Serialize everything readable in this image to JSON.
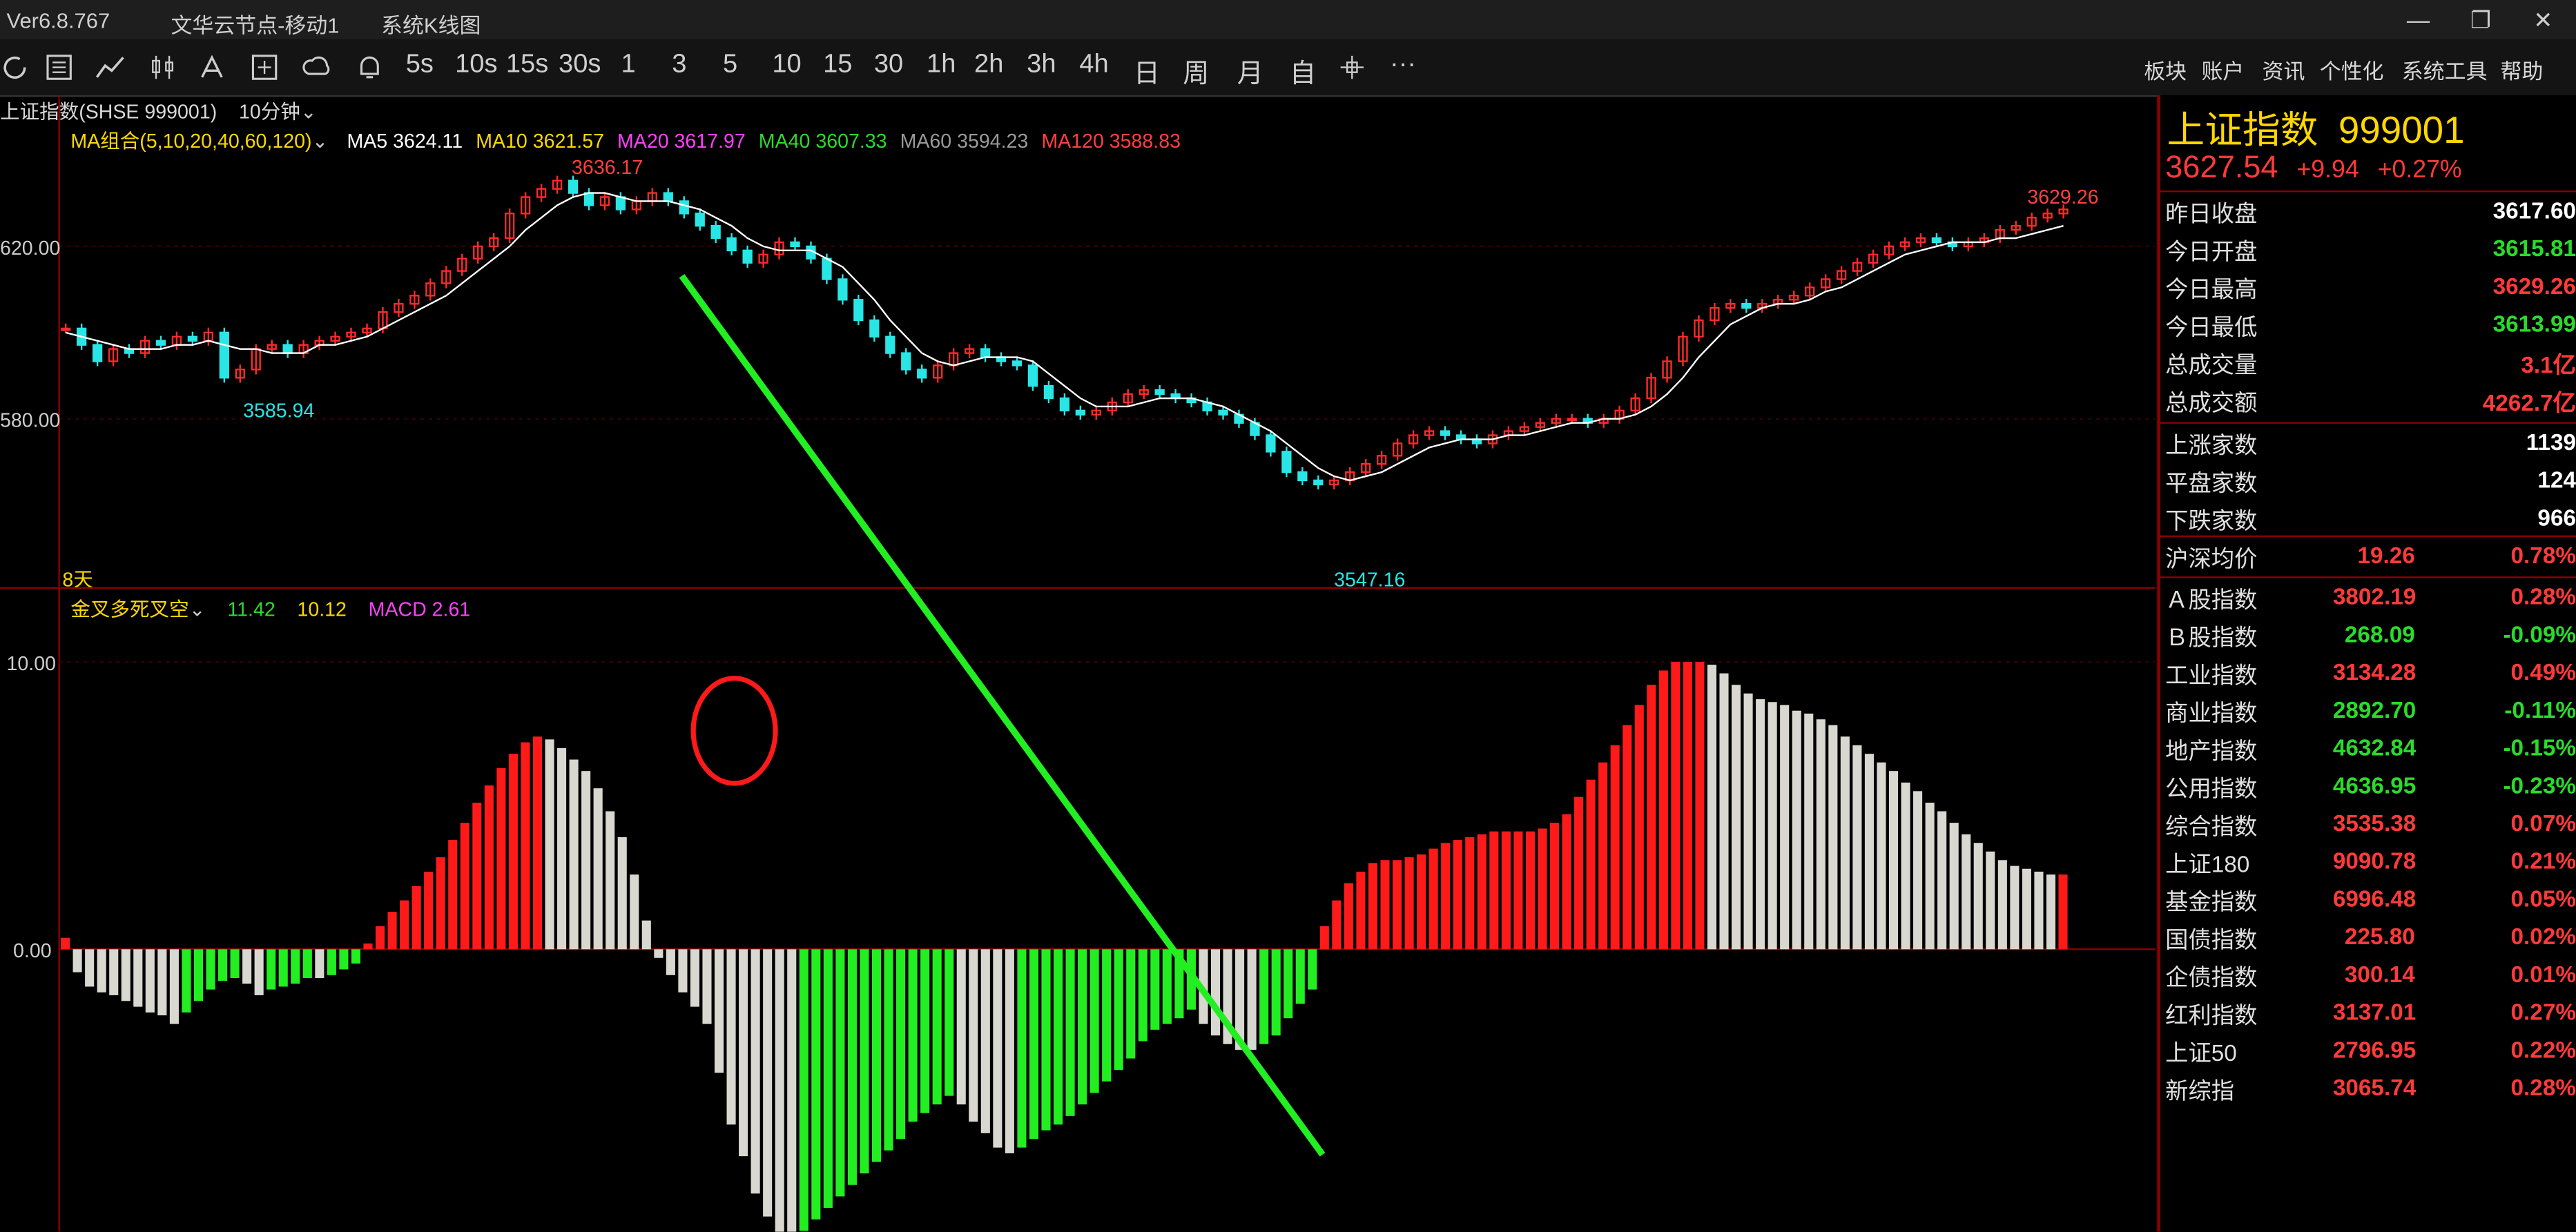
{
  "titlebar": {
    "version": "Ver6.8.767",
    "node": "文华云节点-移动1",
    "chart_name": "系统K线图",
    "minimize": "—",
    "restore": "❐",
    "close": "✕"
  },
  "toolbar": {
    "periods": [
      "5s",
      "10s",
      "15s",
      "30s",
      "1",
      "3",
      "5",
      "10",
      "15",
      "30",
      "1h",
      "2h",
      "3h",
      "4h",
      "日",
      "周",
      "月",
      "自"
    ],
    "menus": [
      "板块",
      "账户",
      "资讯",
      "个性化",
      "系统工具",
      "帮助"
    ],
    "more": "···"
  },
  "chart_header": {
    "symbol": "上证指数(SHSE  999001)",
    "period": "10分钟",
    "ma_label": "MA组合(5,10,20,40,60,120)",
    "ma": [
      {
        "text": "MA5 3624.11",
        "color": "#ffffff"
      },
      {
        "text": "MA10 3621.57",
        "color": "#ffd700"
      },
      {
        "text": "MA20 3617.97",
        "color": "#ff40ff"
      },
      {
        "text": "MA40 3607.33",
        "color": "#2bdb2b"
      },
      {
        "text": "MA60 3594.23",
        "color": "#9a9a9a"
      },
      {
        "text": "MA120 3588.83",
        "color": "#ff4040"
      }
    ],
    "days_label": "8天"
  },
  "price_annotations": {
    "high": "3636.17",
    "low_left": "3585.94",
    "low_mid": "3547.16",
    "high_right": "3629.26"
  },
  "y_labels_price": [
    "620.00",
    "580.00"
  ],
  "indicator_header": {
    "name": "金叉多死叉空",
    "v1": "11.42",
    "v2": "10.12",
    "macd": "MACD 2.61"
  },
  "y_labels_macd": [
    "10.00",
    "0.00"
  ],
  "quote": {
    "name": "上证指数",
    "code": "999001",
    "price": "3627.54",
    "change": "+9.94",
    "pct": "+0.27%"
  },
  "stats": [
    {
      "label": "昨日收盘",
      "value": "3617.60",
      "color": "white"
    },
    {
      "label": "今日开盘",
      "value": "3615.81",
      "color": "green"
    },
    {
      "label": "今日最高",
      "value": "3629.26",
      "color": "red"
    },
    {
      "label": "今日最低",
      "value": "3613.99",
      "color": "green"
    },
    {
      "label": "总成交量",
      "value": "3.1亿",
      "color": "red"
    },
    {
      "label": "总成交额",
      "value": "4262.7亿",
      "color": "red"
    }
  ],
  "breadth": [
    {
      "label": "上涨家数",
      "value": "1139"
    },
    {
      "label": "平盘家数",
      "value": "124"
    },
    {
      "label": "下跌家数",
      "value": "966"
    }
  ],
  "hs_avg": {
    "label": "沪深均价",
    "value": "19.26",
    "pct": "0.78%"
  },
  "indices": [
    {
      "label": "Ａ股指数",
      "value": "3802.19",
      "pct": "0.28%",
      "color": "red"
    },
    {
      "label": "Ｂ股指数",
      "value": "268.09",
      "pct": "-0.09%",
      "color": "green"
    },
    {
      "label": "工业指数",
      "value": "3134.28",
      "pct": "0.49%",
      "color": "red"
    },
    {
      "label": "商业指数",
      "value": "2892.70",
      "pct": "-0.11%",
      "color": "green"
    },
    {
      "label": "地产指数",
      "value": "4632.84",
      "pct": "-0.15%",
      "color": "green"
    },
    {
      "label": "公用指数",
      "value": "4636.95",
      "pct": "-0.23%",
      "color": "green"
    },
    {
      "label": "综合指数",
      "value": "3535.38",
      "pct": "0.07%",
      "color": "red"
    },
    {
      "label": "上证180",
      "value": "9090.78",
      "pct": "0.21%",
      "color": "red"
    },
    {
      "label": "基金指数",
      "value": "6996.48",
      "pct": "0.05%",
      "color": "red"
    },
    {
      "label": "国债指数",
      "value": "225.80",
      "pct": "0.02%",
      "color": "red"
    },
    {
      "label": "企债指数",
      "value": "300.14",
      "pct": "0.01%",
      "color": "red"
    },
    {
      "label": "红利指数",
      "value": "3137.01",
      "pct": "0.27%",
      "color": "red"
    },
    {
      "label": "上证50",
      "value": "2796.95",
      "pct": "0.22%",
      "color": "red"
    },
    {
      "label": "新综指",
      "value": "3065.74",
      "pct": "0.28%",
      "color": "red"
    }
  ],
  "colors": {
    "up": "#ff2a2a",
    "down": "#29e6e6",
    "macd_up": "#ff1a1a",
    "macd_pos_fade": "#d8d8d0",
    "macd_down": "#22ee22",
    "macd_neg_fade": "#d8d8d0",
    "accent": "#ff3a3a",
    "arrow": "#22ee22"
  },
  "chart_data": [
    {
      "type": "candlestick",
      "title": "上证指数 10分钟",
      "ylim": [
        3540,
        3640
      ],
      "close": [
        3600,
        3596,
        3592,
        3595,
        3594,
        3597,
        3596,
        3598,
        3597,
        3599,
        3588,
        3590,
        3595,
        3596,
        3594,
        3596,
        3597,
        3598,
        3599,
        3600,
        3604,
        3606,
        3608,
        3611,
        3614,
        3617,
        3620,
        3622,
        3628,
        3632,
        3634,
        3636,
        3633,
        3630,
        3632,
        3629,
        3631,
        3633,
        3631,
        3628,
        3625,
        3622,
        3619,
        3616,
        3618,
        3621,
        3620,
        3617,
        3612,
        3607,
        3602,
        3598,
        3594,
        3590,
        3588,
        3591,
        3594,
        3595,
        3593,
        3592,
        3591,
        3586,
        3583,
        3580,
        3579,
        3580,
        3582,
        3584,
        3585,
        3584,
        3583,
        3582,
        3580,
        3579,
        3577,
        3574,
        3570,
        3565,
        3563,
        3562,
        3563,
        3565,
        3567,
        3569,
        3572,
        3574,
        3575,
        3574,
        3573,
        3572,
        3574,
        3575,
        3576,
        3577,
        3578,
        3578,
        3577,
        3578,
        3580,
        3583,
        3588,
        3592,
        3598,
        3602,
        3605,
        3606,
        3605,
        3606,
        3607,
        3608,
        3610,
        3612,
        3614,
        3616,
        3618,
        3620,
        3621,
        3622,
        3621,
        3620,
        3621,
        3622,
        3624,
        3625,
        3627,
        3628,
        3629
      ],
      "ma5": [
        3599,
        3598,
        3597,
        3596,
        3595,
        3595,
        3595,
        3596,
        3596,
        3597,
        3596,
        3595,
        3595,
        3594,
        3594,
        3594,
        3596,
        3596,
        3597,
        3598,
        3600,
        3602,
        3604,
        3606,
        3608,
        3611,
        3614,
        3617,
        3620,
        3624,
        3627,
        3630,
        3632,
        3633,
        3633,
        3632,
        3631,
        3631,
        3631,
        3630,
        3629,
        3627,
        3625,
        3622,
        3620,
        3619,
        3619,
        3619,
        3617,
        3615,
        3611,
        3607,
        3602,
        3598,
        3594,
        3592,
        3591,
        3592,
        3593,
        3593,
        3593,
        3592,
        3589,
        3586,
        3583,
        3581,
        3581,
        3581,
        3582,
        3583,
        3583,
        3583,
        3582,
        3581,
        3579,
        3577,
        3575,
        3572,
        3569,
        3566,
        3564,
        3563,
        3564,
        3565,
        3567,
        3569,
        3571,
        3572,
        3573,
        3573,
        3573,
        3574,
        3574,
        3575,
        3576,
        3577,
        3577,
        3578,
        3578,
        3579,
        3581,
        3584,
        3588,
        3593,
        3597,
        3601,
        3603,
        3605,
        3606,
        3606,
        3607,
        3609,
        3610,
        3612,
        3614,
        3616,
        3618,
        3619,
        3620,
        3621,
        3621,
        3621,
        3622,
        3622,
        3623,
        3624,
        3625
      ],
      "macd_hist": [
        0.4,
        -0.8,
        -1.3,
        -1.5,
        -1.6,
        -1.8,
        -2.0,
        -2.2,
        -2.3,
        -2.6,
        -2.2,
        -1.8,
        -1.4,
        -1.1,
        -1.0,
        -1.2,
        -1.6,
        -1.4,
        -1.3,
        -1.2,
        -1.0,
        -1.0,
        -0.9,
        -0.7,
        -0.5,
        0.2,
        0.8,
        1.3,
        1.7,
        2.2,
        2.7,
        3.2,
        3.8,
        4.4,
        5.1,
        5.7,
        6.3,
        6.8,
        7.2,
        7.4,
        7.3,
        7.0,
        6.6,
        6.2,
        5.6,
        4.8,
        3.9,
        2.6,
        1.0,
        -0.3,
        -0.9,
        -1.5,
        -2.0,
        -2.6,
        -4.3,
        -6.1,
        -7.2,
        -8.5,
        -9.3,
        -10.0,
        -10.0,
        -9.8,
        -9.4,
        -9.0,
        -8.6,
        -8.2,
        -7.8,
        -7.4,
        -7.0,
        -6.6,
        -6.0,
        -5.7,
        -5.4,
        -5.1,
        -5.4,
        -6.0,
        -6.4,
        -6.9,
        -7.1,
        -6.9,
        -6.6,
        -6.3,
        -6.1,
        -5.8,
        -5.4,
        -5.0,
        -4.6,
        -4.2,
        -3.8,
        -3.2,
        -2.8,
        -2.6,
        -2.4,
        -2.1,
        -2.6,
        -3.0,
        -3.3,
        -3.5,
        -3.5,
        -3.3,
        -3.0,
        -2.4,
        -1.9,
        -1.4,
        0.8,
        1.7,
        2.3,
        2.7,
        3.0,
        3.1,
        3.1,
        3.2,
        3.3,
        3.5,
        3.7,
        3.8,
        3.9,
        4.0,
        4.1,
        4.1,
        4.1,
        4.1,
        4.2,
        4.4,
        4.7,
        5.3,
        5.9,
        6.5,
        7.1,
        7.8,
        8.5,
        9.2,
        9.7,
        10.0,
        10.0,
        10.0,
        9.9,
        9.6,
        9.2,
        8.9,
        8.7,
        8.6,
        8.5,
        8.3,
        8.2,
        8.0,
        7.8,
        7.4,
        7.1,
        6.8,
        6.5,
        6.2,
        5.8,
        5.5,
        5.1,
        4.8,
        4.4,
        4.0,
        3.7,
        3.4,
        3.1,
        2.9,
        2.8,
        2.7,
        2.6,
        2.6
      ]
    }
  ]
}
